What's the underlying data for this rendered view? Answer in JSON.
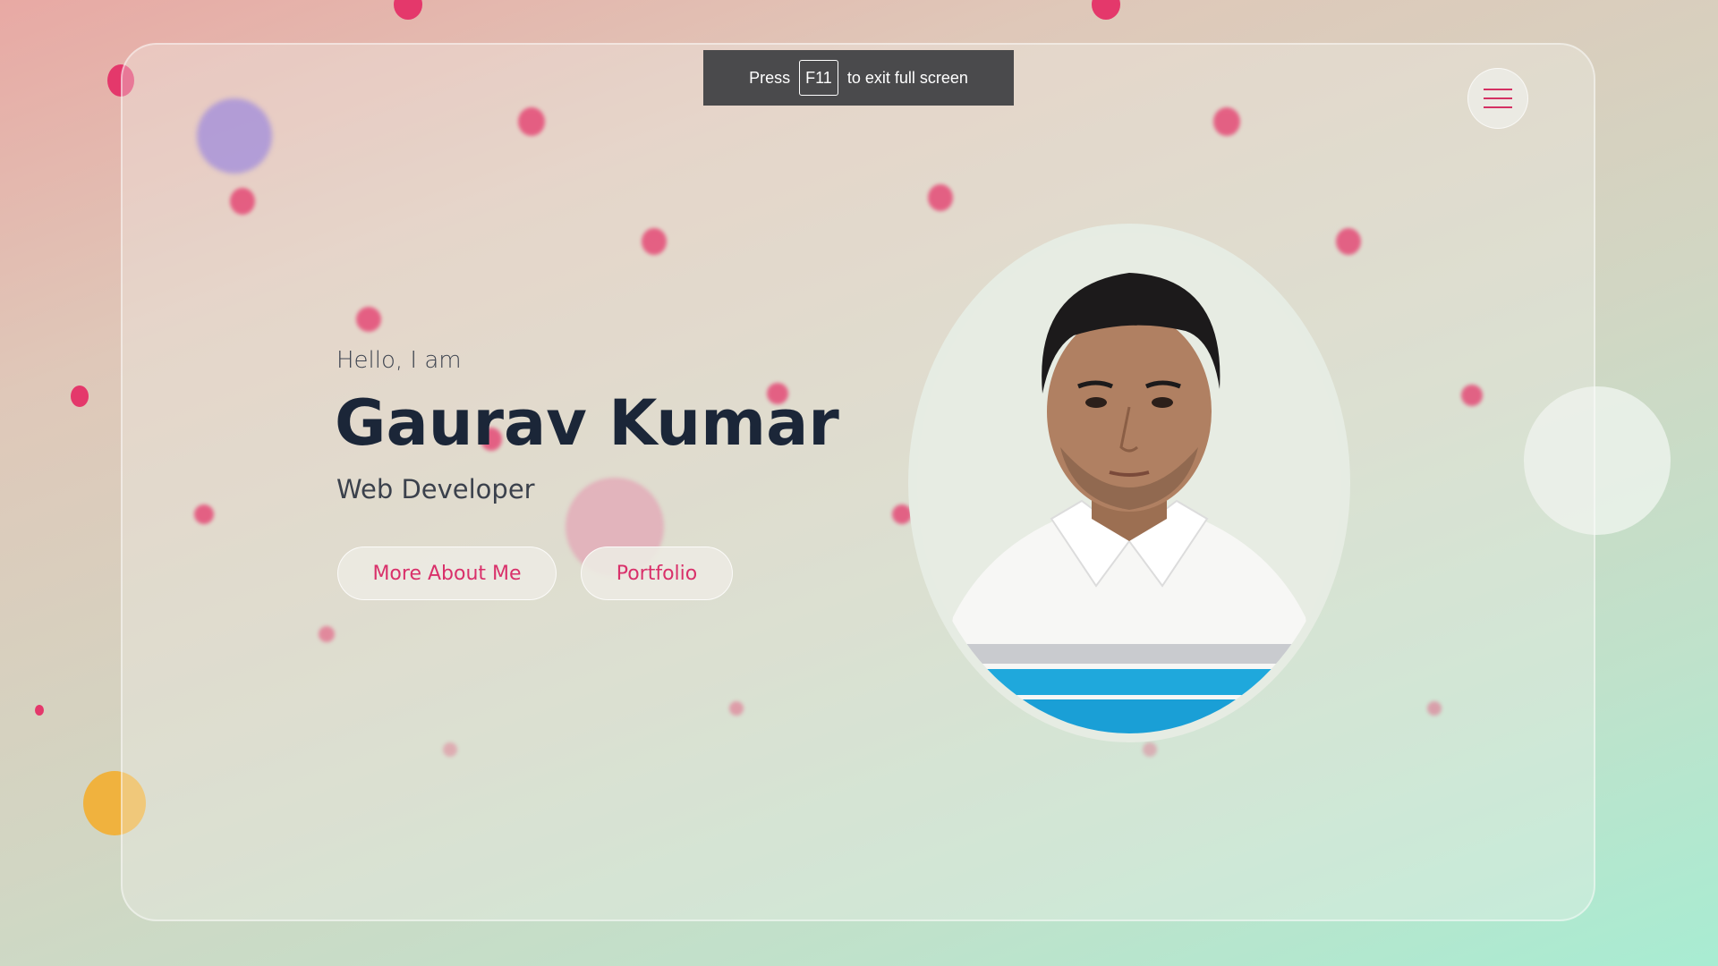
{
  "toast": {
    "prefix": "Press",
    "key": "F11",
    "suffix": "to exit full screen"
  },
  "menu": {
    "icon": "hamburger-menu-icon"
  },
  "hero": {
    "greeting": "Hello, I am",
    "name": "Gaurav Kumar",
    "role": "Web Developer",
    "buttons": {
      "about": "More About Me",
      "portfolio": "Portfolio"
    }
  },
  "colors": {
    "accent": "#e4386b",
    "name_text": "#1b2638",
    "toast_bg": "#4a4a4c"
  }
}
